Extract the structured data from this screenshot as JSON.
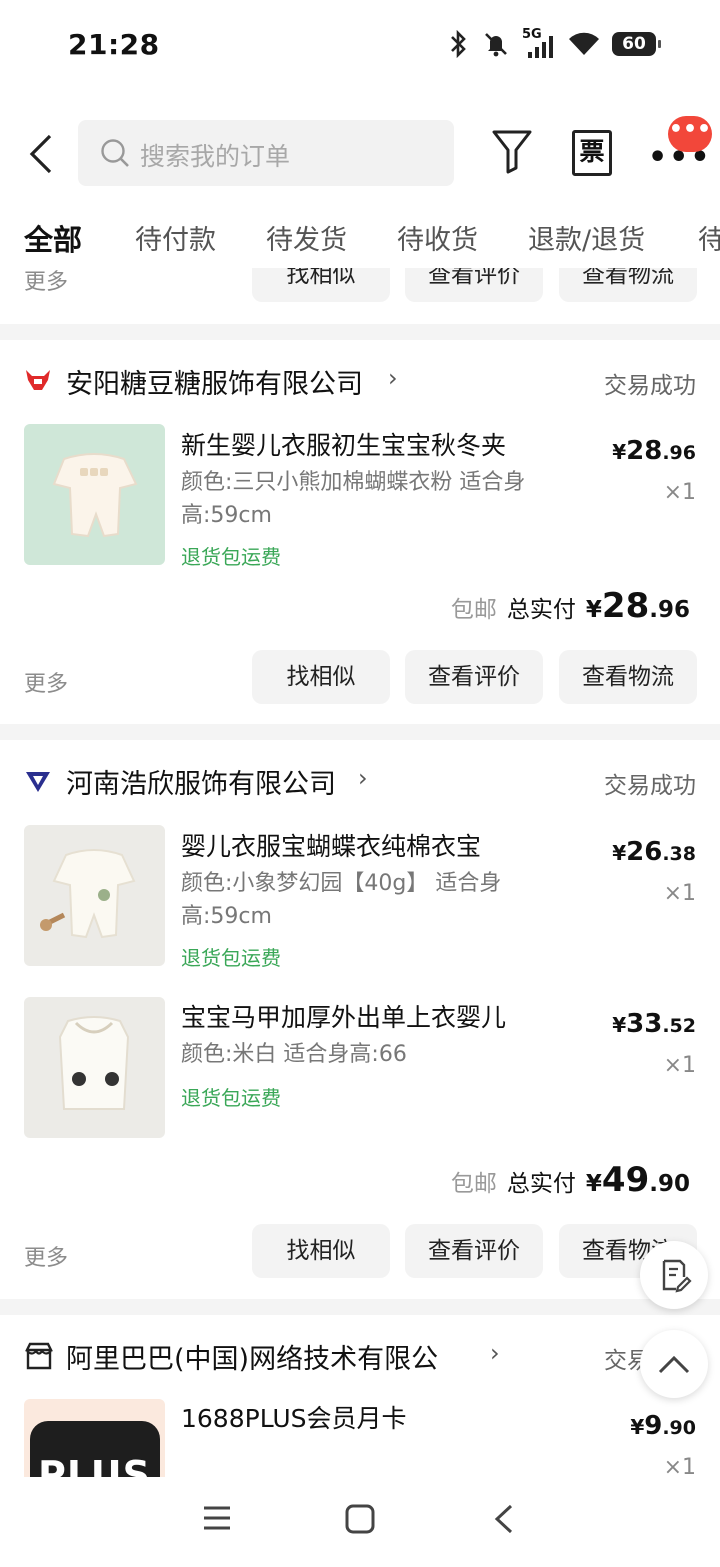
{
  "status_bar": {
    "time": "21:28",
    "network": "5G",
    "battery": "60"
  },
  "header": {
    "search_placeholder": "搜索我的订单",
    "invoice_label": "票",
    "more_label": "•••",
    "badge_label": "•••"
  },
  "tabs": [
    {
      "label": "全部",
      "active": true
    },
    {
      "label": "待付款"
    },
    {
      "label": "待发货"
    },
    {
      "label": "待收货"
    },
    {
      "label": "退款/退货"
    },
    {
      "label": "待"
    }
  ],
  "top_partial": {
    "more_label": "更多",
    "buttons": [
      "找相似",
      "查看评价",
      "查看物流"
    ]
  },
  "orders": [
    {
      "shop_name": "安阳糖豆糖服饰有限公司",
      "status": "交易成功",
      "items": [
        {
          "title": "新生婴儿衣服初生宝宝秋冬夹",
          "spec": "颜色:三只小熊加棉蝴蝶衣粉 适合身高:59cm",
          "tag": "退货包运费",
          "price_currency": "¥",
          "price_int": "28",
          "price_dec": ".96",
          "qty": "×1"
        }
      ],
      "shipping": "包邮",
      "total_label": "总实付",
      "total_currency": "¥",
      "total_int": "28",
      "total_dec": ".96",
      "more_label": "更多",
      "buttons": [
        "找相似",
        "查看评价",
        "查看物流"
      ]
    },
    {
      "shop_name": "河南浩欣服饰有限公司",
      "status": "交易成功",
      "items": [
        {
          "title": "婴儿衣服宝蝴蝶衣纯棉衣宝",
          "spec": "颜色:小象梦幻园【40g】 适合身高:59cm",
          "tag": "退货包运费",
          "price_currency": "¥",
          "price_int": "26",
          "price_dec": ".38",
          "qty": "×1"
        },
        {
          "title": "宝宝马甲加厚外出单上衣婴儿",
          "spec": "颜色:米白 适合身高:66",
          "tag": "退货包运费",
          "price_currency": "¥",
          "price_int": "33",
          "price_dec": ".52",
          "qty": "×1"
        }
      ],
      "shipping": "包邮",
      "total_label": "总实付",
      "total_currency": "¥",
      "total_int": "49",
      "total_dec": ".90",
      "more_label": "更多",
      "buttons": [
        "找相似",
        "查看评价",
        "查看物流"
      ]
    },
    {
      "shop_name": "阿里巴巴(中国)网络技术有限公",
      "status": "交易成功",
      "items": [
        {
          "title": "1688PLUS会员月卡",
          "thumb_text": "PLUS",
          "price_currency": "¥",
          "price_int": "9",
          "price_dec": ".90",
          "qty": "×1"
        }
      ]
    }
  ],
  "colors": {
    "accent_red": "#f2473a",
    "tag_green": "#3aa757",
    "background": "#f4f4f4"
  }
}
